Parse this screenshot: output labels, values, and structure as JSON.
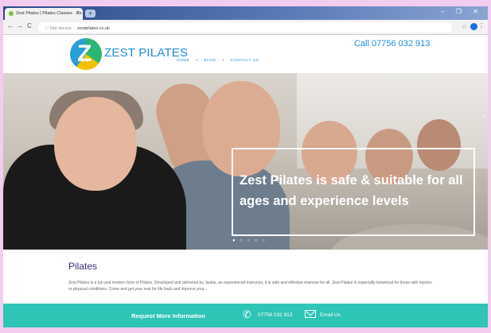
{
  "browser": {
    "tab_title": "Zest Pilates | Pilates Classes · Ce",
    "tab_close": "×",
    "new_tab": "+",
    "window_controls": "‒ ❐ ✕",
    "back": "←",
    "forward": "→",
    "reload": "C",
    "security": "ⓘ Not secure",
    "url": "zestpilates.co.uk",
    "star": "☆",
    "menu": "⋮"
  },
  "header": {
    "logo_text": "ZEST PILATES",
    "nav": [
      "HOME",
      "•",
      "BLOG",
      "•",
      "CONTACT US"
    ],
    "phone": "Call 07756 032 913"
  },
  "hero": {
    "headline": "Zest Pilates is safe & suitable for all ages and experience levels",
    "dots": "● ○ ○ ○ ○",
    "next": "›"
  },
  "content": {
    "heading": "Pilates",
    "body": "Zest Pilates is a fun and modern form of Pilates. Developed and delivered by Jackie, an experienced instructor, it is safe and effective exercise for all. Zest Pilates is especially beneficial for those with injuries or physical conditions. Come and get your zest for life back and improve your..."
  },
  "footer_bar": {
    "request_label": "Request More Information",
    "phone": "07756 032 913",
    "email": "Email Us",
    "phone_icon": "phone-icon",
    "mail_icon": "mail-icon"
  },
  "colors": {
    "accent": "#1d8dd8",
    "heading": "#3b2a7a",
    "cta_bar": "#2ec4b6"
  }
}
